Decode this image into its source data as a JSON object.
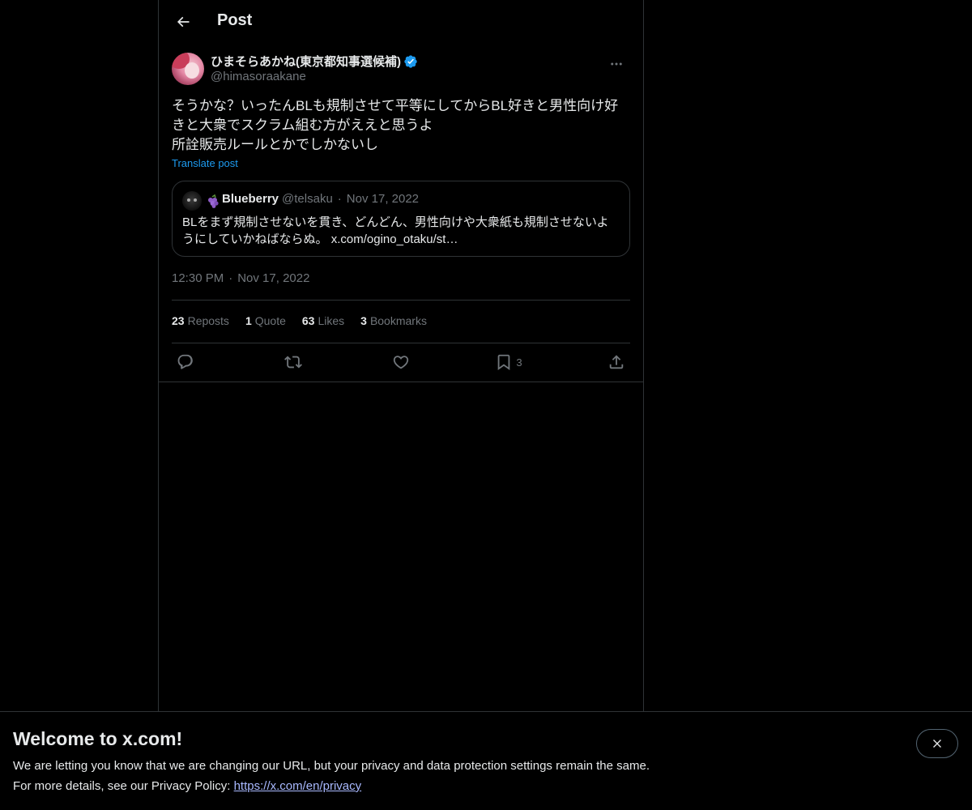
{
  "header": {
    "title": "Post"
  },
  "post": {
    "author_name": "ひまそらあかね(東京都知事選候補)",
    "author_handle": "@himasoraakane",
    "text": "そうかな？いったんBLも規制させて平等にしてからBL好きと男性向け好きと大衆でスクラム組む方がええと思うよ\n所詮販売ルールとかでしかないし",
    "translate_label": "Translate post",
    "time": "12:30 PM",
    "date": "Nov 17, 2022",
    "separator": "·"
  },
  "quote": {
    "name": "Blueberry",
    "handle": "@telsaku",
    "separator": "·",
    "date": "Nov 17, 2022",
    "text": "BLをまず規制させないを貫き、どんどん、男性向けや大衆紙も規制させないようにしていかねばならぬ。 x.com/ogino_otaku/st…"
  },
  "stats": {
    "reposts_count": "23",
    "reposts_label": "Reposts",
    "quotes_count": "1",
    "quotes_label": "Quote",
    "likes_count": "63",
    "likes_label": "Likes",
    "bookmarks_count": "3",
    "bookmarks_label": "Bookmarks"
  },
  "actions": {
    "bookmark_count": "3",
    "icons": [
      "reply-icon",
      "repost-icon",
      "like-icon",
      "bookmark-icon",
      "share-icon"
    ]
  },
  "banner": {
    "title": "Welcome to x.com!",
    "line1": "We are letting you know that we are changing our URL, but your privacy and data protection settings remain the same.",
    "line2_prefix": "For more details, see our Privacy Policy: ",
    "link": "https://x.com/en/privacy"
  },
  "colors": {
    "background": "#000000",
    "text": "#e7e9ea",
    "muted": "#71767b",
    "accent": "#1d9bf0",
    "border": "#2f3336",
    "link": "#a9b9ff"
  }
}
